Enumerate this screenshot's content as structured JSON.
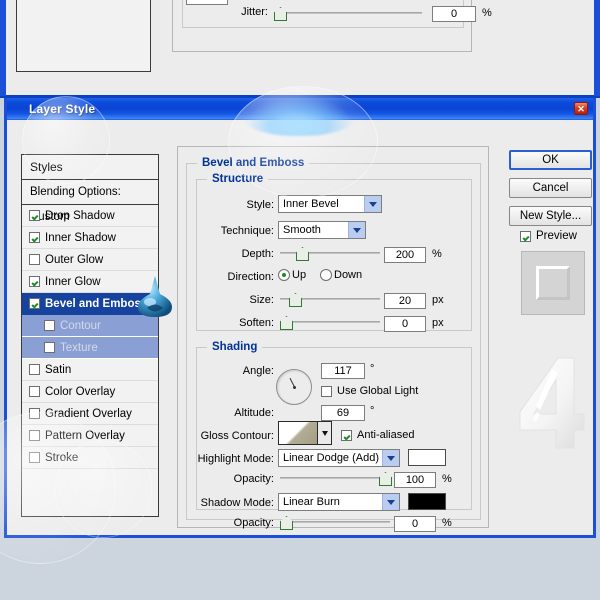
{
  "background_dialog": {
    "jitter_label": "Jitter:",
    "jitter_value": "0",
    "jitter_unit": "%"
  },
  "dialog": {
    "title": "Layer Style",
    "close_icon": "close-icon"
  },
  "styles_list": {
    "header": "Styles",
    "blending_options": "Blending Options: Custom",
    "items": [
      {
        "label": "Drop Shadow",
        "checked": true,
        "selected": false,
        "sub": false
      },
      {
        "label": "Inner Shadow",
        "checked": true,
        "selected": false,
        "sub": false
      },
      {
        "label": "Outer Glow",
        "checked": false,
        "selected": false,
        "sub": false
      },
      {
        "label": "Inner Glow",
        "checked": true,
        "selected": false,
        "sub": false
      },
      {
        "label": "Bevel and Emboss",
        "checked": true,
        "selected": true,
        "sub": false
      },
      {
        "label": "Contour",
        "checked": false,
        "selected": false,
        "sub": true
      },
      {
        "label": "Texture",
        "checked": false,
        "selected": false,
        "sub": true
      },
      {
        "label": "Satin",
        "checked": false,
        "selected": false,
        "sub": false
      },
      {
        "label": "Color Overlay",
        "checked": false,
        "selected": false,
        "sub": false
      },
      {
        "label": "Gradient Overlay",
        "checked": false,
        "selected": false,
        "sub": false
      },
      {
        "label": "Pattern Overlay",
        "checked": false,
        "selected": false,
        "sub": false
      },
      {
        "label": "Stroke",
        "checked": false,
        "selected": false,
        "sub": false
      }
    ]
  },
  "settings": {
    "panel_title": "Bevel and Emboss",
    "structure": {
      "title": "Structure",
      "style_label": "Style:",
      "style_value": "Inner Bevel",
      "technique_label": "Technique:",
      "technique_value": "Smooth",
      "depth_label": "Depth:",
      "depth_value": "200",
      "depth_unit": "%",
      "direction_label": "Direction:",
      "direction_up": "Up",
      "direction_down": "Down",
      "direction_selected": "Up",
      "size_label": "Size:",
      "size_value": "20",
      "size_unit": "px",
      "soften_label": "Soften:",
      "soften_value": "0",
      "soften_unit": "px"
    },
    "shading": {
      "title": "Shading",
      "angle_label": "Angle:",
      "angle_value": "117",
      "angle_unit": "°",
      "use_global_light_label": "Use Global Light",
      "use_global_light_checked": false,
      "altitude_label": "Altitude:",
      "altitude_value": "69",
      "altitude_unit": "°",
      "gloss_contour_label": "Gloss Contour:",
      "anti_aliased_label": "Anti-aliased",
      "anti_aliased_checked": true,
      "highlight_mode_label": "Highlight Mode:",
      "highlight_mode_value": "Linear Dodge (Add)",
      "highlight_color": "#ffffff",
      "highlight_opacity_label": "Opacity:",
      "highlight_opacity_value": "100",
      "highlight_opacity_unit": "%",
      "shadow_mode_label": "Shadow Mode:",
      "shadow_mode_value": "Linear Burn",
      "shadow_color": "#000000",
      "shadow_opacity_label": "Opacity:",
      "shadow_opacity_value": "0",
      "shadow_opacity_unit": "%"
    }
  },
  "buttons": {
    "ok": "OK",
    "cancel": "Cancel",
    "new_style": "New Style...",
    "preview_label": "Preview",
    "preview_checked": true
  },
  "colors": {
    "titlebar_blue": "#0d4ddb",
    "dialog_border": "#1b4fd8",
    "group_title": "#00339a",
    "selection_blue": "#15439e",
    "sub_selection_blue": "#8a9fd4",
    "check_green": "#1d8a2a",
    "desktop": "#ccd4de"
  },
  "artwork": {
    "numeral": "4",
    "droplet_icon": "water-droplet-icon"
  }
}
